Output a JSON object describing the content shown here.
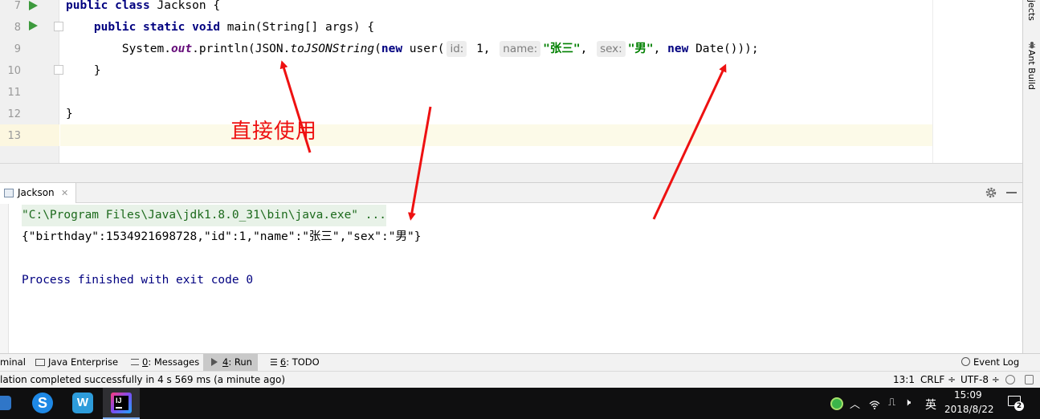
{
  "editor": {
    "line_numbers": [
      "7",
      "8",
      "9",
      "10",
      "11",
      "12",
      "13"
    ],
    "line7": {
      "kw": "public class",
      "name": " Jackson {"
    },
    "line8": {
      "indent": "    ",
      "kw": "public static void",
      "rest": " main(String[] args) {"
    },
    "line9": {
      "indent": "        ",
      "sys": "System.",
      "out": "out",
      "println": ".println(JSON.",
      "method": "toJSONString",
      "paren": "(",
      "new1": "new",
      "user": " user(",
      "hint_id": "id:",
      "val_id": " 1,",
      "hint_name": "name:",
      "val_name": "\"张三\"",
      "comma": ",",
      "hint_sex": "sex:",
      "val_sex": "\"男\"",
      "comma2": ", ",
      "new2": "new",
      "end": " Date()));"
    },
    "line10": "    }",
    "line12": "}"
  },
  "right_strip": {
    "projects": "jects",
    "ant_build": "Ant Build"
  },
  "run_panel": {
    "tab_label": "Jackson",
    "console_lines": {
      "command": "\"C:\\Program Files\\Java\\jdk1.8.0_31\\bin\\java.exe\" ...",
      "output": "{\"birthday\":1534921698728,\"id\":1,\"name\":\"张三\",\"sex\":\"男\"}",
      "finished": "Process finished with exit code 0"
    }
  },
  "tool_windows": {
    "terminal": "minal",
    "java_enterprise": "Java Enterprise",
    "messages_num": "0",
    "messages": ": Messages",
    "run_num": "4",
    "run": ": Run",
    "todo_num": "6",
    "todo": ": TODO",
    "event_log": "Event Log"
  },
  "status_bar": {
    "message": "lation completed successfully in 4 s 569 ms (a minute ago)",
    "position": "13:1",
    "line_sep": "CRLF ÷",
    "encoding": "UTF-8 ÷"
  },
  "taskbar": {
    "ime": "英",
    "time": "15:09",
    "date": "2018/8/22",
    "notification_count": "2"
  },
  "annotation": {
    "text": "直接使用"
  },
  "colors": {
    "keyword": "#000080",
    "string": "#008000",
    "static_field": "#660e7a",
    "arrow": "#ee1111",
    "console_blue": "#000080"
  }
}
